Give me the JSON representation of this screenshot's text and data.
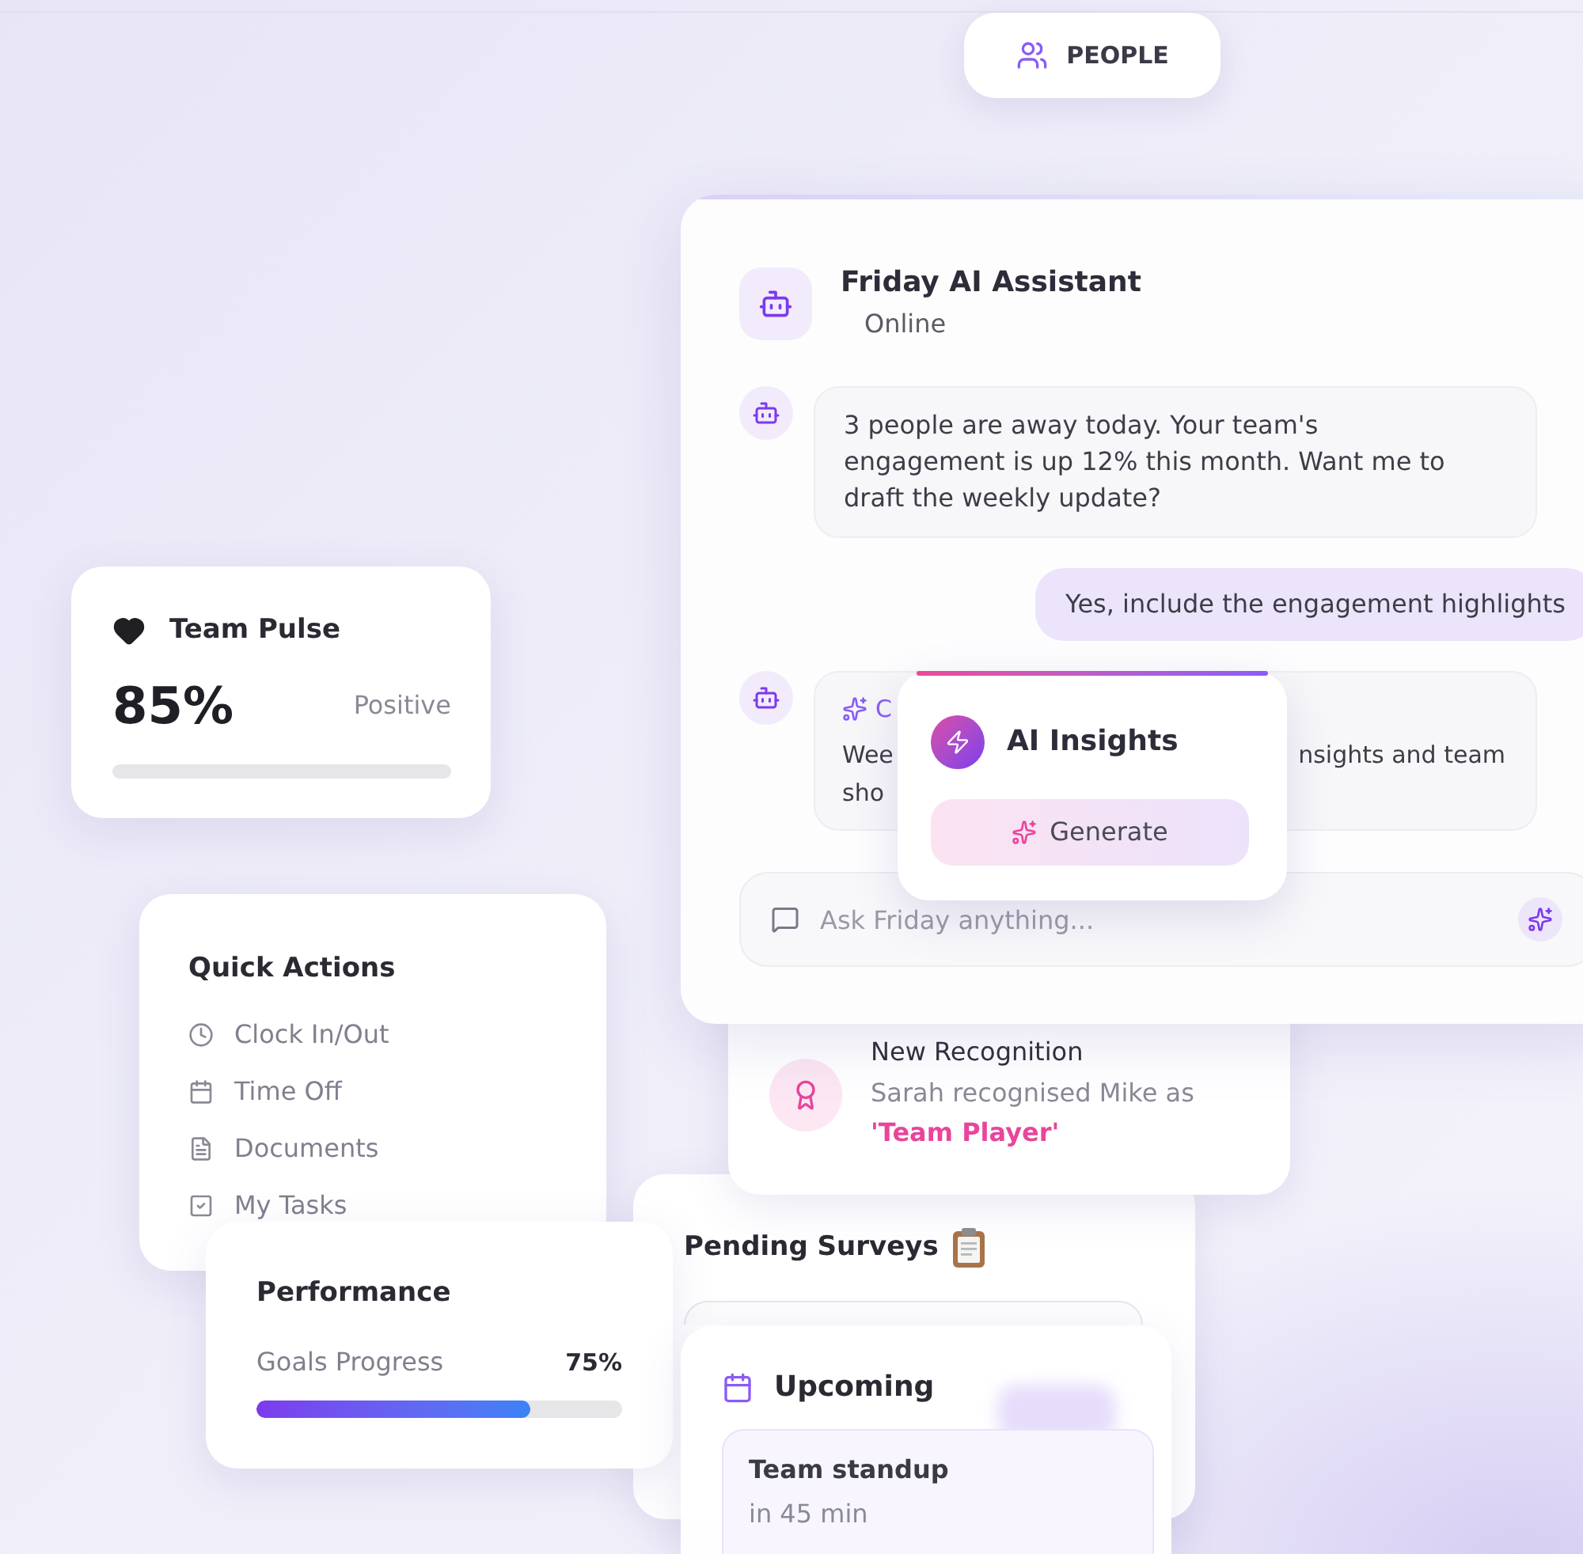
{
  "nav_pill": {
    "label": "PEOPLE"
  },
  "assistant": {
    "title": "Friday AI Assistant",
    "status": "Online",
    "messages": [
      {
        "kind": "bot",
        "text": "3 people are away today. Your team's engagement is up 12% this month. Want me to draft the weekly update?"
      },
      {
        "kind": "user",
        "text": "Yes, include the engagement highlights"
      },
      {
        "kind": "bot_partial",
        "heading": "C",
        "line_1_left": "Wee",
        "line_1_right": "nsights and team",
        "line_2": "sho"
      }
    ],
    "input": {
      "placeholder": "Ask Friday anything..."
    }
  },
  "insights_popover": {
    "title": "AI Insights",
    "button": "Generate"
  },
  "team_pulse": {
    "title": "Team Pulse",
    "value": "85%",
    "sentiment": "Positive"
  },
  "quick_actions": {
    "title": "Quick Actions",
    "items": [
      {
        "label": "Clock In/Out"
      },
      {
        "label": "Time Off"
      },
      {
        "label": "Documents"
      },
      {
        "label": "My Tasks"
      }
    ]
  },
  "recognition": {
    "title": "New Recognition",
    "text": "Sarah recognised Mike as **'Team Player'**"
  },
  "pending_surveys": {
    "title": "Pending Surveys"
  },
  "performance": {
    "title": "Performance",
    "metric": "Goals Progress",
    "value": "75%",
    "level": 0.75
  },
  "upcoming": {
    "title": "Upcoming",
    "events": [
      {
        "title": "Team standup",
        "time": "in 45 min"
      }
    ]
  }
}
